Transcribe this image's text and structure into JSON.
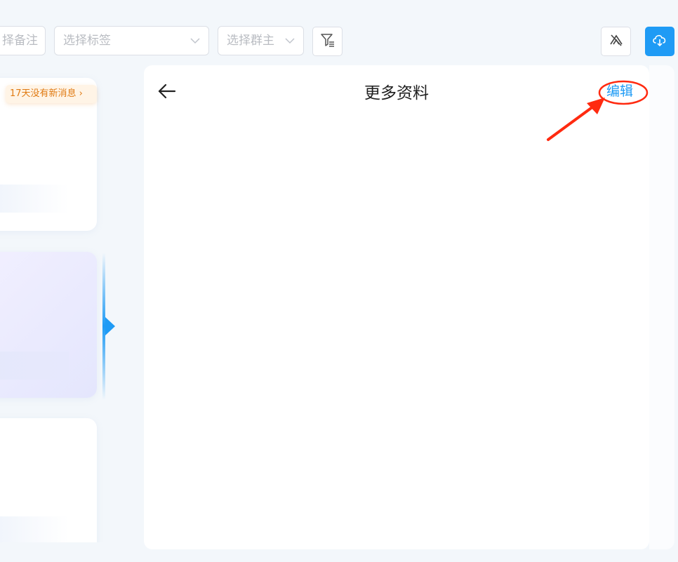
{
  "toolbar": {
    "remark_placeholder": "择备注",
    "tag_placeholder": "选择标签",
    "owner_placeholder": "选择群主"
  },
  "list": {
    "badge_text": "17天没有新消息 ›"
  },
  "panel": {
    "title": "更多资料",
    "edit_label": "编辑"
  },
  "colors": {
    "accent": "#1f9bf5",
    "annotation": "#ff2a10",
    "badge_text": "#e07a12"
  }
}
